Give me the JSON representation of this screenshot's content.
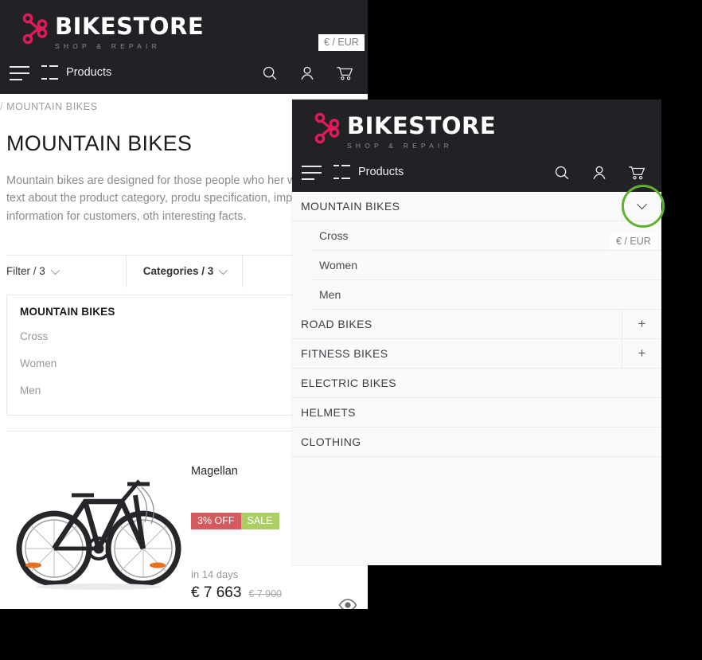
{
  "site": {
    "logo_title": "BIKESTORE",
    "logo_subtitle": "SHOP & REPAIR",
    "currency": "€ / EUR",
    "nav": {
      "products_label": "Products",
      "icons": [
        "search-icon",
        "account-icon",
        "cart-icon"
      ]
    }
  },
  "breadcrumb": {
    "separator": "/",
    "current": "MOUNTAIN BIKES"
  },
  "category_page": {
    "title": "MOUNTAIN BIKES",
    "description": "Mountain bikes are designed for those people who her write additional text about the product category, produ specification, important information for customers, oth interesting facts.",
    "filters": [
      {
        "label": "Filter / 3",
        "bold": false
      },
      {
        "label": "Categories / 3",
        "bold": true
      }
    ],
    "category_card": {
      "heading": "MOUNTAIN BIKES",
      "items": [
        "Cross",
        "Women",
        "Men"
      ]
    },
    "product": {
      "name": "Magellan",
      "badges": [
        {
          "text": "3% OFF",
          "color": "#d35a5e"
        },
        {
          "text": "SALE",
          "color": "#aace63"
        }
      ],
      "availability": "in 14 days",
      "price": "€ 7 663",
      "price_old": "€ 7 900",
      "quick_view_icon": "eye-icon"
    }
  },
  "overlay_panel": {
    "logo_title": "BIKESTORE",
    "logo_subtitle": "SHOP & REPAIR",
    "currency": "€ / EUR",
    "products_label": "Products",
    "menu": [
      {
        "label": "MOUNTAIN BIKES",
        "state": "expanded",
        "toggle": "chevron-down-icon",
        "children": [
          "Cross",
          "Women",
          "Men"
        ]
      },
      {
        "label": "ROAD BIKES",
        "state": "collapsed",
        "toggle": "+",
        "children": []
      },
      {
        "label": "FITNESS BIKES",
        "state": "collapsed",
        "toggle": "+",
        "children": []
      },
      {
        "label": "ELECTRIC BIKES",
        "state": "leaf",
        "toggle": "",
        "children": []
      },
      {
        "label": "HELMETS",
        "state": "leaf",
        "toggle": "",
        "children": []
      },
      {
        "label": "CLOTHING",
        "state": "leaf",
        "toggle": "",
        "children": []
      }
    ]
  },
  "annotation": {
    "highlight_color": "#5fb22e",
    "target": "mountain-bikes-expand-toggle"
  },
  "colors": {
    "header_bg": "#222226",
    "logo_accent": "#e01b5a",
    "page_bg": "#ffffff",
    "panel_bg": "#fafafa",
    "backdrop": "#000000"
  }
}
